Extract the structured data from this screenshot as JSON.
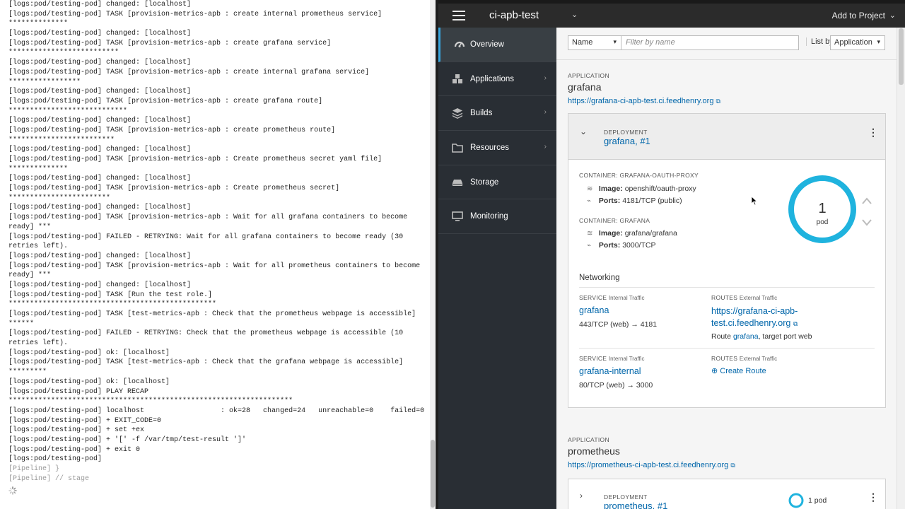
{
  "console": {
    "lines": [
      {
        "text": "[logs:pod/testing-pod] changed: [localhost]",
        "muted": false
      },
      {
        "text": "[logs:pod/testing-pod] TASK [provision-metrics-apb : create internal prometheus service]",
        "muted": false
      },
      {
        "text": "**************",
        "muted": false
      },
      {
        "text": "[logs:pod/testing-pod] changed: [localhost]",
        "muted": false
      },
      {
        "text": "[logs:pod/testing-pod] TASK [provision-metrics-apb : create grafana service]",
        "muted": false
      },
      {
        "text": "**************************",
        "muted": false
      },
      {
        "text": "[logs:pod/testing-pod] changed: [localhost]",
        "muted": false
      },
      {
        "text": "[logs:pod/testing-pod] TASK [provision-metrics-apb : create internal grafana service]",
        "muted": false
      },
      {
        "text": "*****************",
        "muted": false
      },
      {
        "text": "[logs:pod/testing-pod] changed: [localhost]",
        "muted": false
      },
      {
        "text": "[logs:pod/testing-pod] TASK [provision-metrics-apb : create grafana route]",
        "muted": false
      },
      {
        "text": "****************************",
        "muted": false
      },
      {
        "text": "[logs:pod/testing-pod] changed: [localhost]",
        "muted": false
      },
      {
        "text": "[logs:pod/testing-pod] TASK [provision-metrics-apb : create prometheus route]",
        "muted": false
      },
      {
        "text": "*************************",
        "muted": false
      },
      {
        "text": "[logs:pod/testing-pod] changed: [localhost]",
        "muted": false
      },
      {
        "text": "[logs:pod/testing-pod] TASK [provision-metrics-apb : Create prometheus secret yaml file]",
        "muted": false
      },
      {
        "text": "**************",
        "muted": false
      },
      {
        "text": "[logs:pod/testing-pod] changed: [localhost]",
        "muted": false
      },
      {
        "text": "[logs:pod/testing-pod] TASK [provision-metrics-apb : Create prometheus secret]",
        "muted": false
      },
      {
        "text": "************************",
        "muted": false
      },
      {
        "text": "[logs:pod/testing-pod] changed: [localhost]",
        "muted": false
      },
      {
        "text": "[logs:pod/testing-pod] TASK [provision-metrics-apb : Wait for all grafana containers to become",
        "muted": false
      },
      {
        "text": "ready] ***",
        "muted": false
      },
      {
        "text": "[logs:pod/testing-pod] FAILED - RETRYING: Wait for all grafana containers to become ready (30",
        "muted": false
      },
      {
        "text": "retries left).",
        "muted": false
      },
      {
        "text": "[logs:pod/testing-pod] changed: [localhost]",
        "muted": false
      },
      {
        "text": "[logs:pod/testing-pod] TASK [provision-metrics-apb : Wait for all prometheus containers to become",
        "muted": false
      },
      {
        "text": "ready] ***",
        "muted": false
      },
      {
        "text": "[logs:pod/testing-pod] changed: [localhost]",
        "muted": false
      },
      {
        "text": "[logs:pod/testing-pod] TASK [Run the test role.]",
        "muted": false
      },
      {
        "text": "*************************************************",
        "muted": false
      },
      {
        "text": "[logs:pod/testing-pod] TASK [test-metrics-apb : Check that the prometheus webpage is accessible]",
        "muted": false
      },
      {
        "text": "******",
        "muted": false
      },
      {
        "text": "[logs:pod/testing-pod] FAILED - RETRYING: Check that the prometheus webpage is accessible (10",
        "muted": false
      },
      {
        "text": "retries left).",
        "muted": false
      },
      {
        "text": "[logs:pod/testing-pod] ok: [localhost]",
        "muted": false
      },
      {
        "text": "[logs:pod/testing-pod] TASK [test-metrics-apb : Check that the grafana webpage is accessible]",
        "muted": false
      },
      {
        "text": "*********",
        "muted": false
      },
      {
        "text": "[logs:pod/testing-pod] ok: [localhost]",
        "muted": false
      },
      {
        "text": "[logs:pod/testing-pod] PLAY RECAP",
        "muted": false
      },
      {
        "text": "*******************************************************************",
        "muted": false
      },
      {
        "text": "[logs:pod/testing-pod] localhost                  : ok=28   changed=24   unreachable=0    failed=0",
        "muted": false
      },
      {
        "text": "[logs:pod/testing-pod] + EXIT_CODE=0",
        "muted": false
      },
      {
        "text": "[logs:pod/testing-pod] + set +ex",
        "muted": false
      },
      {
        "text": "[logs:pod/testing-pod] + '[' -f /var/tmp/test-result ']'",
        "muted": false
      },
      {
        "text": "[logs:pod/testing-pod] + exit 0",
        "muted": false
      },
      {
        "text": "[logs:pod/testing-pod]",
        "muted": false
      },
      {
        "text": "[Pipeline] }",
        "muted": true
      },
      {
        "text": "[Pipeline] // stage",
        "muted": true
      }
    ]
  },
  "topbar": {
    "project": "ci-apb-test",
    "add_to_project": "Add to Project"
  },
  "sidebar": {
    "items": [
      {
        "label": "Overview",
        "icon": "dashboard-icon"
      },
      {
        "label": "Applications",
        "icon": "cubes-icon"
      },
      {
        "label": "Builds",
        "icon": "layers-icon"
      },
      {
        "label": "Resources",
        "icon": "folder-icon"
      },
      {
        "label": "Storage",
        "icon": "storage-icon"
      },
      {
        "label": "Monitoring",
        "icon": "monitor-icon"
      }
    ]
  },
  "filter": {
    "field": "Name",
    "placeholder": "Filter by name",
    "list_by_label": "List by",
    "list_by_value": "Application"
  },
  "apps": [
    {
      "label": "APPLICATION",
      "name": "grafana",
      "url": "https://grafana-ci-apb-test.ci.feedhenry.org",
      "deployment": {
        "label": "DEPLOYMENT",
        "name": "grafana, #1",
        "pods": "1",
        "pods_unit": "pod",
        "containers": [
          {
            "label": "CONTAINER: GRAFANA-OAUTH-PROXY",
            "image_label": "Image:",
            "image": "openshift/oauth-proxy",
            "ports_label": "Ports:",
            "ports": "4181/TCP (public)"
          },
          {
            "label": "CONTAINER: GRAFANA",
            "image_label": "Image:",
            "image": "grafana/grafana",
            "ports_label": "Ports:",
            "ports": "3000/TCP"
          }
        ],
        "networking": {
          "title": "Networking",
          "service_head": "SERVICE",
          "service_sub": "Internal Traffic",
          "routes_head": "ROUTES",
          "routes_sub": "External Traffic",
          "rows": [
            {
              "service": "grafana",
              "mapping": "443/TCP (web) → 4181",
              "route": "https://grafana-ci-apb-test.ci.feedhenry.org",
              "route_prefix": "Route",
              "route_name": "grafana",
              "route_suffix": ", target port web"
            },
            {
              "service": "grafana-internal",
              "mapping": "80/TCP (web) → 3000",
              "route": "Create Route"
            }
          ]
        }
      }
    },
    {
      "label": "APPLICATION",
      "name": "prometheus",
      "url": "https://prometheus-ci-apb-test.ci.feedhenry.org",
      "deployment": {
        "label": "DEPLOYMENT",
        "name": "prometheus, #1",
        "pods": "1 pod"
      }
    }
  ],
  "colors": {
    "accent": "#39a5dc",
    "link": "#0066aa",
    "donut": "#1fb3de",
    "nav_bg": "#292e34"
  }
}
